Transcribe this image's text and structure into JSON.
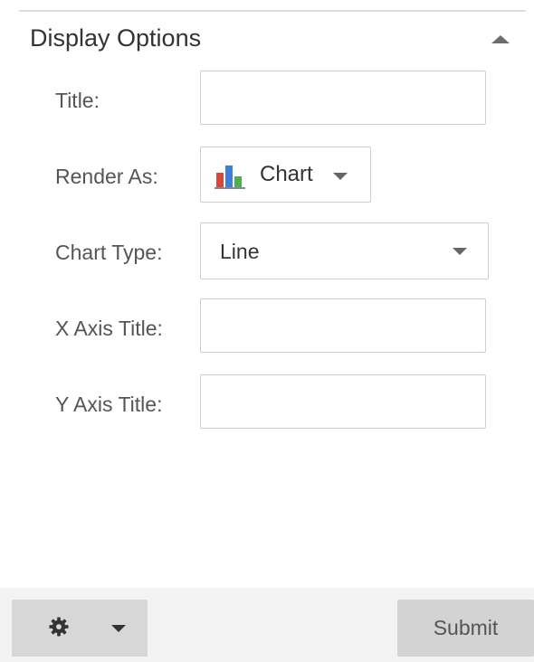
{
  "section": {
    "title": "Display Options"
  },
  "fields": {
    "title": {
      "label": "Title:",
      "value": ""
    },
    "render_as": {
      "label": "Render As:",
      "value": "Chart",
      "icon": "bar-chart-icon"
    },
    "chart_type": {
      "label": "Chart Type:",
      "value": "Line"
    },
    "x_axis_title": {
      "label": "X Axis Title:",
      "value": ""
    },
    "y_axis_title": {
      "label": "Y Axis Title:",
      "value": ""
    }
  },
  "footer": {
    "settings_icon": "gear-icon",
    "submit_label": "Submit"
  },
  "colors": {
    "chart_icon_red": "#d9463e",
    "chart_icon_blue": "#3e7fd9",
    "chart_icon_green": "#4caf50",
    "chart_icon_base": "#8a8a8a"
  }
}
